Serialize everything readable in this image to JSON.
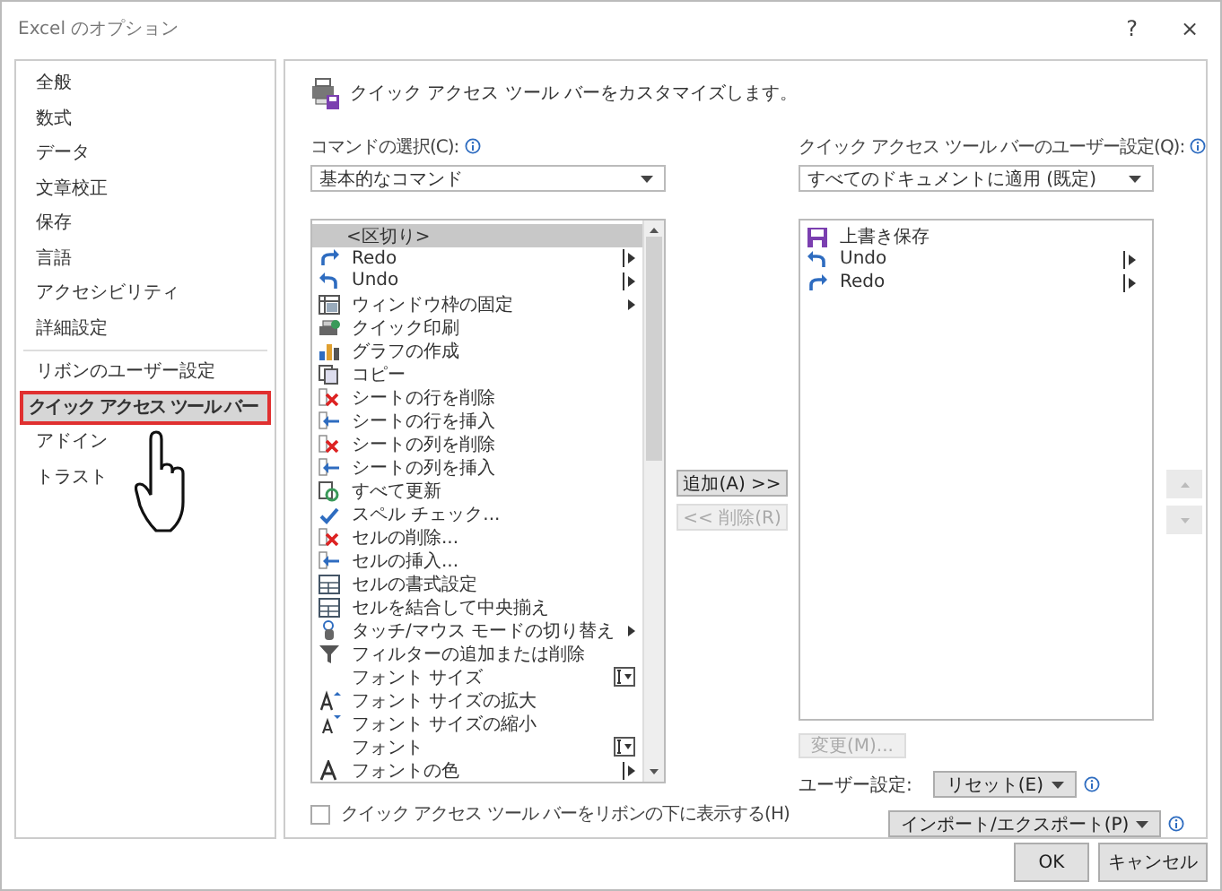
{
  "window": {
    "title": "Excel のオプション",
    "help": "?",
    "close": "×"
  },
  "sidebar": {
    "groups": [
      [
        {
          "label": "全般",
          "selected": false
        },
        {
          "label": "数式",
          "selected": false
        },
        {
          "label": "データ",
          "selected": false
        },
        {
          "label": "文章校正",
          "selected": false
        },
        {
          "label": "保存",
          "selected": false
        },
        {
          "label": "言語",
          "selected": false
        },
        {
          "label": "アクセシビリティ",
          "selected": false
        },
        {
          "label": "詳細設定",
          "selected": false
        }
      ],
      [
        {
          "label": "リボンのユーザー設定",
          "selected": false
        },
        {
          "label": "クイック アクセス ツール バー",
          "selected": true
        },
        {
          "label": "アドイン",
          "selected": false
        },
        {
          "label": "トラスト",
          "selected": false
        }
      ]
    ]
  },
  "header": "クイック アクセス ツール バーをカスタマイズします。",
  "commands": {
    "label": "コマンドの選択(C):",
    "dropdown": "基本的なコマンド",
    "items": [
      {
        "label": "<区切り>",
        "kind": "separator",
        "selected": true
      },
      {
        "label": "Redo",
        "kind": "redo",
        "trailing": {
          "kind": "split"
        },
        "selected": false
      },
      {
        "label": "Undo",
        "kind": "undo",
        "trailing": {
          "kind": "split"
        },
        "selected": false
      },
      {
        "label": "ウィンドウ枠の固定",
        "kind": "freeze",
        "trailing": {
          "kind": "arrow"
        },
        "selected": false
      },
      {
        "label": "クイック印刷",
        "kind": "print",
        "selected": false
      },
      {
        "label": "グラフの作成",
        "kind": "chart",
        "selected": false
      },
      {
        "label": "コピー",
        "kind": "copy",
        "selected": false
      },
      {
        "label": "シートの行を削除",
        "kind": "delete",
        "selected": false
      },
      {
        "label": "シートの行を挿入",
        "kind": "insert",
        "selected": false
      },
      {
        "label": "シートの列を削除",
        "kind": "delete",
        "selected": false
      },
      {
        "label": "シートの列を挿入",
        "kind": "insert",
        "selected": false
      },
      {
        "label": "すべて更新",
        "kind": "refresh",
        "selected": false
      },
      {
        "label": "スペル チェック...",
        "kind": "spell",
        "selected": false
      },
      {
        "label": "セルの削除...",
        "kind": "delete",
        "selected": false
      },
      {
        "label": "セルの挿入...",
        "kind": "insert",
        "selected": false
      },
      {
        "label": "セルの書式設定",
        "kind": "grid",
        "selected": false
      },
      {
        "label": "セルを結合して中央揃え",
        "kind": "grid",
        "selected": false
      },
      {
        "label": "タッチ/マウス モードの切り替え",
        "kind": "touch",
        "trailing": {
          "kind": "arrow"
        },
        "selected": false
      },
      {
        "label": "フィルターの追加または削除",
        "kind": "filter",
        "selected": false
      },
      {
        "label": "フォント サイズ",
        "kind": "none",
        "trailing": {
          "kind": "combo"
        },
        "selected": false
      },
      {
        "label": "フォント サイズの拡大",
        "kind": "font-up",
        "selected": false
      },
      {
        "label": "フォント サイズの縮小",
        "kind": "font-down",
        "selected": false
      },
      {
        "label": "フォント",
        "kind": "none",
        "trailing": {
          "kind": "combo"
        },
        "selected": false
      },
      {
        "label": "フォントの色",
        "kind": "font-color",
        "trailing": {
          "kind": "split"
        },
        "selected": false
      }
    ],
    "checkbox": {
      "label": "クイック アクセス ツール バーをリボンの下に表示する(H)",
      "checked": false
    }
  },
  "middle": {
    "add": {
      "label": "追加(A) >>",
      "disabled": false
    },
    "remove": {
      "label": "<< 削除(R)",
      "disabled": true
    }
  },
  "qat": {
    "label": "クイック アクセス ツール バーのユーザー設定(Q):",
    "dropdown": "すべてのドキュメントに適用 (既定)",
    "items": [
      {
        "label": "上書き保存",
        "kind": "save",
        "selected": false
      },
      {
        "label": "Undo",
        "kind": "undo",
        "trailing": {
          "kind": "split"
        },
        "selected": false
      },
      {
        "label": "Redo",
        "kind": "redo",
        "trailing": {
          "kind": "split"
        },
        "selected": false
      }
    ],
    "modify": {
      "label": "変更(M)...",
      "disabled": true
    },
    "customize_label": "ユーザー設定:",
    "reset": "リセット(E)",
    "import_export": "インポート/エクスポート(P)",
    "move_up_disabled": true,
    "move_down_disabled": true
  },
  "buttons": [
    "OK",
    "キャンセル"
  ]
}
